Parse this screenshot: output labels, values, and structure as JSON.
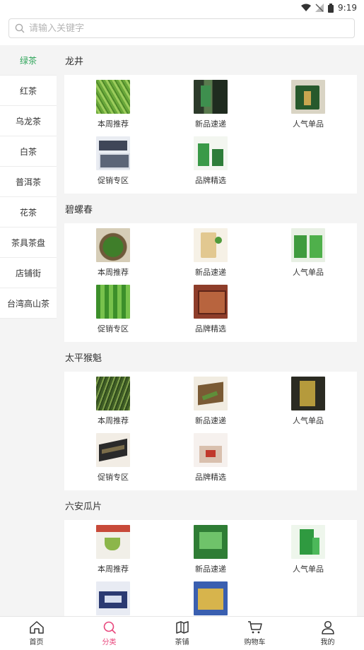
{
  "status_bar": {
    "time": "9:19"
  },
  "search": {
    "placeholder": "请输入关键字"
  },
  "sidebar": {
    "active_index": 0,
    "active_color": "#2fa55a",
    "items": [
      {
        "label": "绿茶"
      },
      {
        "label": "红茶"
      },
      {
        "label": "乌龙茶"
      },
      {
        "label": "白茶"
      },
      {
        "label": "普洱茶"
      },
      {
        "label": "花茶"
      },
      {
        "label": "茶具茶盘"
      },
      {
        "label": "店铺街"
      },
      {
        "label": "台湾高山茶"
      }
    ]
  },
  "sections": [
    {
      "title": "龙井",
      "items": [
        {
          "label": "本周推荐",
          "image": "green-tea-leaves"
        },
        {
          "label": "新品速递",
          "image": "tea-gift-box"
        },
        {
          "label": "人气单品",
          "image": "tea-tin"
        },
        {
          "label": "促销专区",
          "image": "tea-gift-set"
        },
        {
          "label": "品牌精选",
          "image": "green-tea-packs"
        }
      ]
    },
    {
      "title": "碧螺春",
      "items": [
        {
          "label": "本周推荐",
          "image": "tea-in-bowl"
        },
        {
          "label": "新品速递",
          "image": "tea-bag-pack"
        },
        {
          "label": "人气单品",
          "image": "green-tea-tins"
        },
        {
          "label": "促销专区",
          "image": "green-tea-cubes"
        },
        {
          "label": "品牌精选",
          "image": "wooden-gift-box"
        }
      ]
    },
    {
      "title": "太平猴魁",
      "items": [
        {
          "label": "本周推荐",
          "image": "long-tea-leaves"
        },
        {
          "label": "新品速递",
          "image": "tea-box-open"
        },
        {
          "label": "人气单品",
          "image": "tea-tin-dark"
        },
        {
          "label": "促销专区",
          "image": "tea-tray"
        },
        {
          "label": "品牌精选",
          "image": "gift-package"
        }
      ]
    },
    {
      "title": "六安瓜片",
      "items": [
        {
          "label": "本周推荐",
          "image": "tea-cup-poster"
        },
        {
          "label": "新品速递",
          "image": "green-tea-bag"
        },
        {
          "label": "人气单品",
          "image": "green-tea-tin-box"
        },
        {
          "label": "",
          "image": "blue-gift-set"
        },
        {
          "label": "",
          "image": "blue-gold-box"
        }
      ]
    }
  ],
  "tab_bar": {
    "active_index": 1,
    "active_color": "#e8467c",
    "tabs": [
      {
        "label": "首页",
        "icon": "home-icon"
      },
      {
        "label": "分类",
        "icon": "search-icon"
      },
      {
        "label": "茶铺",
        "icon": "map-icon"
      },
      {
        "label": "购物车",
        "icon": "cart-icon"
      },
      {
        "label": "我的",
        "icon": "user-icon"
      }
    ]
  }
}
